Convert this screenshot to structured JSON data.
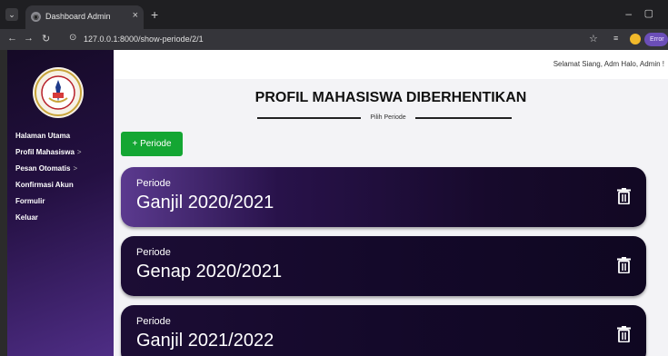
{
  "browser": {
    "tab_title": "Dashboard Admin",
    "tab_close": "×",
    "new_tab": "+",
    "minimize": "–",
    "maximize": "▢",
    "url": "127.0.0.1:8000/show-periode/2/1",
    "error_label": "Error"
  },
  "sidebar": {
    "logo_text": "POLITEKNIK",
    "items": [
      {
        "label": "Halaman Utama",
        "chevron": ""
      },
      {
        "label": "Profil Mahasiswa",
        "chevron": ">"
      },
      {
        "label": "Pesan Otomatis",
        "chevron": ">"
      },
      {
        "label": "Konfirmasi Akun",
        "chevron": ""
      },
      {
        "label": "Formulir",
        "chevron": ""
      },
      {
        "label": "Keluar",
        "chevron": ""
      }
    ]
  },
  "header": {
    "greeting": "Selamat Siang, Adm Halo, Admin !"
  },
  "main": {
    "title": "PROFIL MAHASISWA DIBERHENTIKAN",
    "subtitle": "Pilih Periode",
    "add_button": "+ Periode",
    "periods": [
      {
        "label": "Periode",
        "name": "Ganjil 2020/2021"
      },
      {
        "label": "Periode",
        "name": "Genap 2020/2021"
      },
      {
        "label": "Periode",
        "name": "Ganjil 2021/2022"
      }
    ]
  },
  "colors": {
    "sidebar_gradient": [
      "#150a26",
      "#4e2d85"
    ],
    "card_dark": "#170a2c",
    "add_button": "#14a633"
  }
}
